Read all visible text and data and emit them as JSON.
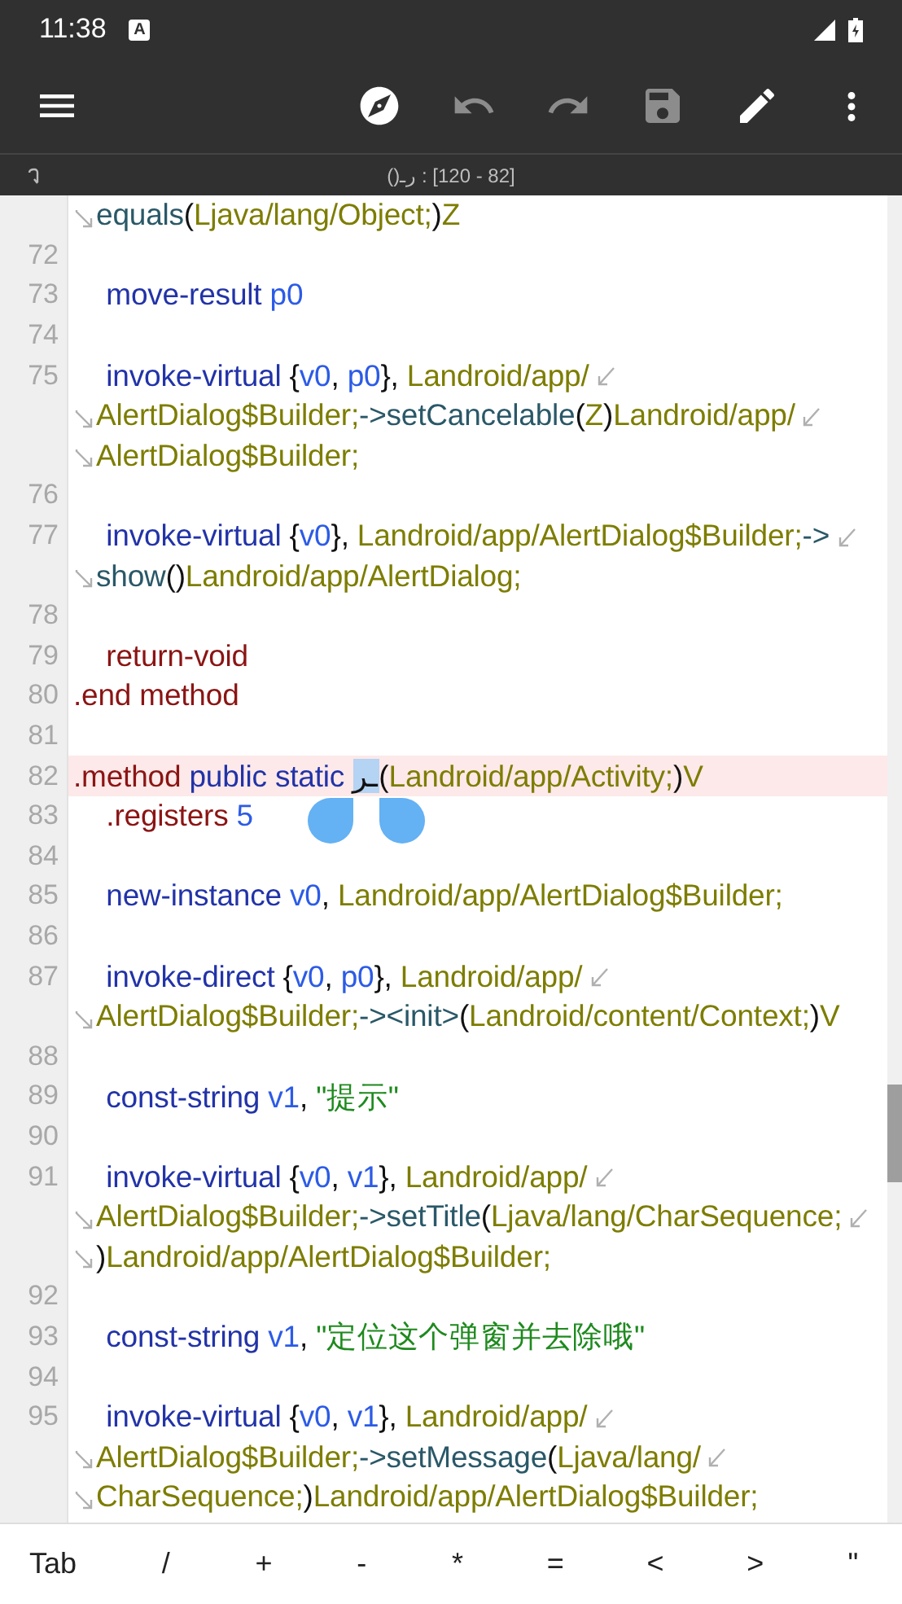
{
  "status_bar": {
    "time": "11:38",
    "badge": "A"
  },
  "toolbar": [
    {
      "kind": "menu",
      "disabled": false
    },
    {
      "kind": "spacer"
    },
    {
      "kind": "compass",
      "disabled": false
    },
    {
      "kind": "undo",
      "disabled": true
    },
    {
      "kind": "redo",
      "disabled": true
    },
    {
      "kind": "save",
      "disabled": true
    },
    {
      "kind": "edit",
      "disabled": false
    },
    {
      "kind": "more",
      "disabled": false
    }
  ],
  "info_bar": {
    "position": "()ـر : [120 - 82]"
  },
  "editor": {
    "rows": [
      {
        "kind": "line",
        "tokens": [
          {
            "kind": "wrap-in"
          },
          {
            "kind": "method",
            "text": "equals"
          },
          {
            "kind": "punct",
            "text": "("
          },
          {
            "kind": "type",
            "text": "Ljava/lang/Object;"
          },
          {
            "kind": "punct",
            "text": ")"
          },
          {
            "kind": "type",
            "text": "Z"
          }
        ]
      },
      {
        "kind": "line",
        "n": "72",
        "tokens": []
      },
      {
        "kind": "line",
        "n": "73",
        "tokens": [
          {
            "kind": "kw",
            "text": "    move-result "
          },
          {
            "kind": "reg",
            "text": "p0"
          }
        ]
      },
      {
        "kind": "line",
        "n": "74",
        "tokens": []
      },
      {
        "kind": "line",
        "n": "75",
        "tokens": [
          {
            "kind": "kw",
            "text": "    invoke-virtual "
          },
          {
            "kind": "punct",
            "text": "{"
          },
          {
            "kind": "reg",
            "text": "v0"
          },
          {
            "kind": "punct",
            "text": ", "
          },
          {
            "kind": "reg",
            "text": "p0"
          },
          {
            "kind": "punct",
            "text": "}, "
          },
          {
            "kind": "type",
            "text": "Landroid/app/"
          },
          {
            "kind": "wrap-out"
          }
        ]
      },
      {
        "kind": "line",
        "tokens": [
          {
            "kind": "wrap-in"
          },
          {
            "kind": "type",
            "text": "AlertDialog$Builder;"
          },
          {
            "kind": "method",
            "text": "->setCancelable"
          },
          {
            "kind": "punct",
            "text": "("
          },
          {
            "kind": "type",
            "text": "Z"
          },
          {
            "kind": "punct",
            "text": ")"
          },
          {
            "kind": "type",
            "text": "Landroid/app/"
          },
          {
            "kind": "wrap-out"
          }
        ]
      },
      {
        "kind": "line",
        "tokens": [
          {
            "kind": "wrap-in"
          },
          {
            "kind": "type",
            "text": "AlertDialog$Builder;"
          }
        ]
      },
      {
        "kind": "line",
        "n": "76",
        "tokens": []
      },
      {
        "kind": "line",
        "n": "77",
        "tokens": [
          {
            "kind": "kw",
            "text": "    invoke-virtual "
          },
          {
            "kind": "punct",
            "text": "{"
          },
          {
            "kind": "reg",
            "text": "v0"
          },
          {
            "kind": "punct",
            "text": "}, "
          },
          {
            "kind": "type",
            "text": "Landroid/app/AlertDialog$Builder;"
          },
          {
            "kind": "method",
            "text": "->"
          },
          {
            "kind": "wrap-out"
          }
        ]
      },
      {
        "kind": "line",
        "tokens": [
          {
            "kind": "wrap-in"
          },
          {
            "kind": "method",
            "text": "show"
          },
          {
            "kind": "punct",
            "text": "()"
          },
          {
            "kind": "type",
            "text": "Landroid/app/AlertDialog;"
          }
        ]
      },
      {
        "kind": "line",
        "n": "78",
        "tokens": []
      },
      {
        "kind": "line",
        "n": "79",
        "tokens": [
          {
            "kind": "directive",
            "text": "    return-void"
          }
        ]
      },
      {
        "kind": "line",
        "n": "80",
        "tokens": [
          {
            "kind": "directive",
            "text": ".end method"
          }
        ]
      },
      {
        "kind": "line",
        "n": "81",
        "tokens": []
      },
      {
        "kind": "current",
        "n": "82",
        "tokens": [
          {
            "kind": "directive",
            "text": ".method "
          },
          {
            "kind": "kw",
            "text": "public static "
          },
          {
            "kind": "selection",
            "text": "ـر"
          },
          {
            "kind": "punct",
            "text": "("
          },
          {
            "kind": "type",
            "text": "Landroid/app/Activity;"
          },
          {
            "kind": "punct",
            "text": ")"
          },
          {
            "kind": "type",
            "text": "V"
          }
        ]
      },
      {
        "kind": "line",
        "n": "83",
        "tokens": [
          {
            "kind": "directive",
            "text": "    .registers "
          },
          {
            "kind": "reg",
            "text": "5"
          }
        ]
      },
      {
        "kind": "line",
        "n": "84",
        "tokens": []
      },
      {
        "kind": "line",
        "n": "85",
        "tokens": [
          {
            "kind": "kw",
            "text": "    new-instance "
          },
          {
            "kind": "reg",
            "text": "v0"
          },
          {
            "kind": "punct",
            "text": ", "
          },
          {
            "kind": "type",
            "text": "Landroid/app/AlertDialog$Builder;"
          }
        ]
      },
      {
        "kind": "line",
        "n": "86",
        "tokens": []
      },
      {
        "kind": "line",
        "n": "87",
        "tokens": [
          {
            "kind": "kw",
            "text": "    invoke-direct "
          },
          {
            "kind": "punct",
            "text": "{"
          },
          {
            "kind": "reg",
            "text": "v0"
          },
          {
            "kind": "punct",
            "text": ", "
          },
          {
            "kind": "reg",
            "text": "p0"
          },
          {
            "kind": "punct",
            "text": "}, "
          },
          {
            "kind": "type",
            "text": "Landroid/app/"
          },
          {
            "kind": "wrap-out"
          }
        ]
      },
      {
        "kind": "line",
        "tokens": [
          {
            "kind": "wrap-in"
          },
          {
            "kind": "type",
            "text": "AlertDialog$Builder;"
          },
          {
            "kind": "method",
            "text": "-><init>"
          },
          {
            "kind": "punct",
            "text": "("
          },
          {
            "kind": "type",
            "text": "Landroid/content/Context;"
          },
          {
            "kind": "punct",
            "text": ")"
          },
          {
            "kind": "type",
            "text": "V"
          }
        ]
      },
      {
        "kind": "line",
        "n": "88",
        "tokens": []
      },
      {
        "kind": "line",
        "n": "89",
        "tokens": [
          {
            "kind": "kw",
            "text": "    const-string "
          },
          {
            "kind": "reg",
            "text": "v1"
          },
          {
            "kind": "punct",
            "text": ", "
          },
          {
            "kind": "string",
            "text": "\"提示\""
          }
        ]
      },
      {
        "kind": "line",
        "n": "90",
        "tokens": []
      },
      {
        "kind": "line",
        "n": "91",
        "tokens": [
          {
            "kind": "kw",
            "text": "    invoke-virtual "
          },
          {
            "kind": "punct",
            "text": "{"
          },
          {
            "kind": "reg",
            "text": "v0"
          },
          {
            "kind": "punct",
            "text": ", "
          },
          {
            "kind": "reg",
            "text": "v1"
          },
          {
            "kind": "punct",
            "text": "}, "
          },
          {
            "kind": "type",
            "text": "Landroid/app/"
          },
          {
            "kind": "wrap-out"
          }
        ]
      },
      {
        "kind": "line",
        "tokens": [
          {
            "kind": "wrap-in"
          },
          {
            "kind": "type",
            "text": "AlertDialog$Builder;"
          },
          {
            "kind": "method",
            "text": "->setTitle"
          },
          {
            "kind": "punct",
            "text": "("
          },
          {
            "kind": "type",
            "text": "Ljava/lang/CharSequence;"
          },
          {
            "kind": "wrap-out"
          }
        ]
      },
      {
        "kind": "line",
        "tokens": [
          {
            "kind": "wrap-in"
          },
          {
            "kind": "punct",
            "text": ")"
          },
          {
            "kind": "type",
            "text": "Landroid/app/AlertDialog$Builder;"
          }
        ]
      },
      {
        "kind": "line",
        "n": "92",
        "tokens": []
      },
      {
        "kind": "line",
        "n": "93",
        "tokens": [
          {
            "kind": "kw",
            "text": "    const-string "
          },
          {
            "kind": "reg",
            "text": "v1"
          },
          {
            "kind": "punct",
            "text": ", "
          },
          {
            "kind": "string",
            "text": "\"定位这个弹窗并去除哦\""
          }
        ]
      },
      {
        "kind": "line",
        "n": "94",
        "tokens": []
      },
      {
        "kind": "line",
        "n": "95",
        "tokens": [
          {
            "kind": "kw",
            "text": "    invoke-virtual "
          },
          {
            "kind": "punct",
            "text": "{"
          },
          {
            "kind": "reg",
            "text": "v0"
          },
          {
            "kind": "punct",
            "text": ", "
          },
          {
            "kind": "reg",
            "text": "v1"
          },
          {
            "kind": "punct",
            "text": "}, "
          },
          {
            "kind": "type",
            "text": "Landroid/app/"
          },
          {
            "kind": "wrap-out"
          }
        ]
      },
      {
        "kind": "line",
        "tokens": [
          {
            "kind": "wrap-in"
          },
          {
            "kind": "type",
            "text": "AlertDialog$Builder;"
          },
          {
            "kind": "method",
            "text": "->setMessage"
          },
          {
            "kind": "punct",
            "text": "("
          },
          {
            "kind": "type",
            "text": "Ljava/lang/"
          },
          {
            "kind": "wrap-out"
          }
        ]
      },
      {
        "kind": "line",
        "tokens": [
          {
            "kind": "wrap-in"
          },
          {
            "kind": "type",
            "text": "CharSequence;"
          },
          {
            "kind": "punct",
            "text": ")"
          },
          {
            "kind": "type",
            "text": "Landroid/app/AlertDialog$Builder;"
          }
        ]
      }
    ]
  },
  "keys": [
    "Tab",
    "/",
    "+",
    "-",
    "*",
    "=",
    "<",
    ">",
    "\""
  ]
}
